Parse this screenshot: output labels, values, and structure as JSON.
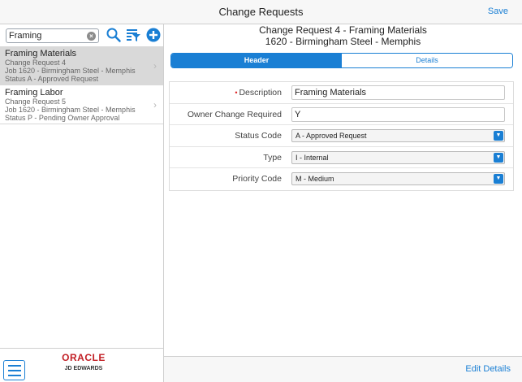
{
  "topbar": {
    "title": "Change Requests",
    "save_label": "Save"
  },
  "search": {
    "value": "Framing"
  },
  "list": [
    {
      "title": "Framing Materials",
      "line1": "Change Request 4",
      "line2": "Job 1620 - Birmingham Steel - Memphis",
      "line3": "Status A - Approved Request",
      "selected": true
    },
    {
      "title": "Framing Labor",
      "line1": "Change Request 5",
      "line2": "Job 1620 - Birmingham Steel - Memphis",
      "line3": "Status P - Pending Owner Approval",
      "selected": false
    }
  ],
  "brand": {
    "name": "ORACLE",
    "sub": "JD EDWARDS",
    "color": "#c21f25"
  },
  "detail": {
    "heading1": "Change Request 4 - Framing Materials",
    "heading2": "1620 - Birmingham Steel - Memphis",
    "tabs": {
      "header": "Header",
      "details": "Details"
    },
    "fields": {
      "description": {
        "label": "Description",
        "value": "Framing Materials"
      },
      "owner_change": {
        "label": "Owner Change Required",
        "value": "Y"
      },
      "status_code": {
        "label": "Status Code",
        "value": "A - Approved Request"
      },
      "type": {
        "label": "Type",
        "value": "I - Internal"
      },
      "priority_code": {
        "label": "Priority Code",
        "value": "M - Medium"
      }
    },
    "edit_details_label": "Edit Details"
  },
  "colors": {
    "accent": "#1a7fd4",
    "selected_row": "#d9d9d9"
  }
}
